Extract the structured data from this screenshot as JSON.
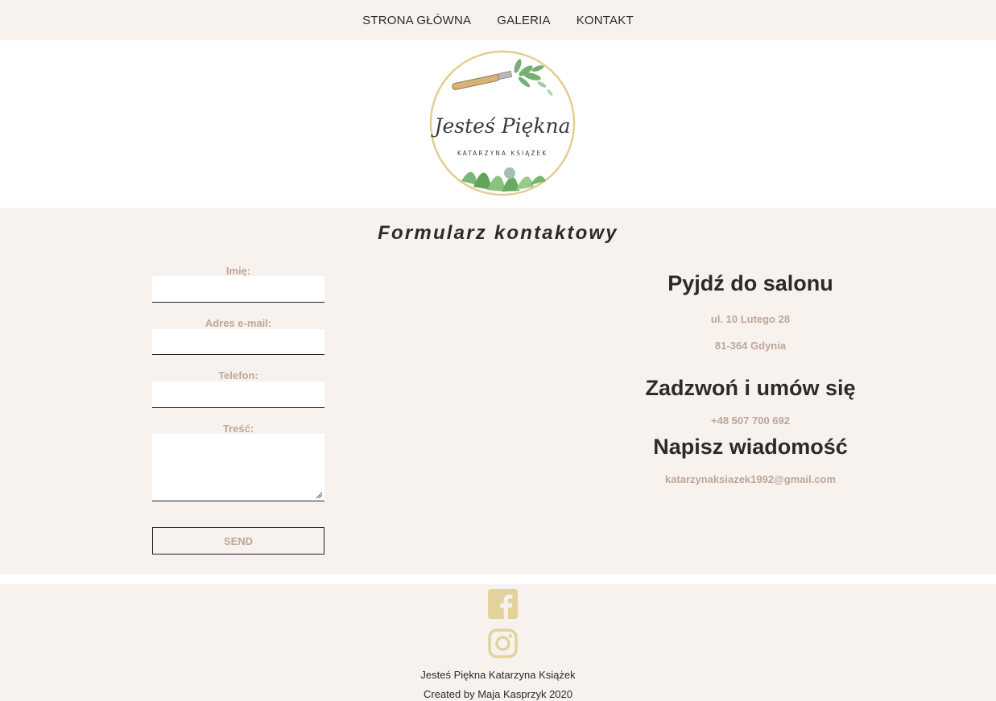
{
  "nav": {
    "items": [
      {
        "label": "STRONA GŁÓWNA"
      },
      {
        "label": "GALERIA"
      },
      {
        "label": "KONTAKT"
      }
    ]
  },
  "logo": {
    "script_text": "Jesteś Piękna",
    "caption": "KATARZYNA KSIĄŻEK",
    "ring_color": "#e2cf8f"
  },
  "form": {
    "title": "Formularz kontaktowy",
    "name_label": "Imię:",
    "email_label": "Adres e-mail:",
    "phone_label": "Telefon:",
    "message_label": "Treść:",
    "name_value": "",
    "email_value": "",
    "phone_value": "",
    "message_value": "",
    "send_label": "SEND"
  },
  "info": {
    "salon_heading": "Pyjdź do salonu",
    "street": "ul. 10 Lutego 28",
    "city": "81-364 Gdynia",
    "call_heading": "Zadzwoń i umów się",
    "phone": "+48 507 700 692",
    "write_heading": "Napisz wiadomość",
    "email": "katarzynaksiazek1992@gmail.com"
  },
  "footer": {
    "icons": [
      "facebook-icon",
      "instagram-icon"
    ],
    "icon_color": "#e2d39c",
    "line1": "Jesteś Piękna Katarzyna Książek",
    "line2": "Created by Maja Kasprzyk 2020"
  },
  "colors": {
    "section_bg": "#f7f2ee",
    "accent_text": "#bfa699",
    "dark_text": "#2b2b2b"
  }
}
